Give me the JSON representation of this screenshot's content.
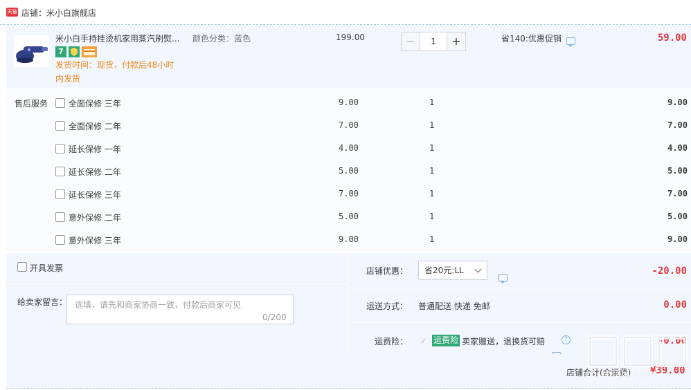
{
  "shop": {
    "logo_text": "天猫",
    "name_label": "店铺：米小白旗舰店"
  },
  "product": {
    "title": "米小白手持挂烫机家用蒸汽刷熨斗",
    "title_display": "米小白手持挂烫机家用蒸汽刷熨...",
    "spec": "颜色分类：蓝色",
    "badge_7": "7",
    "ship_time_line1": "发货时间：现货，付款后48小时",
    "ship_time_line2": "内发货",
    "unit_price": "199.00",
    "quantity": "1",
    "minus": "−",
    "plus": "+",
    "promo": "省140:优惠促销",
    "subtotal": "59.00"
  },
  "services": {
    "label": "售后服务",
    "items": [
      {
        "name": "全面保修 三年",
        "price": "9.00",
        "qty": "1",
        "subtotal": "9.00"
      },
      {
        "name": "全面保修 二年",
        "price": "7.00",
        "qty": "1",
        "subtotal": "7.00"
      },
      {
        "name": "延长保修 一年",
        "price": "4.00",
        "qty": "1",
        "subtotal": "4.00"
      },
      {
        "name": "延长保修 二年",
        "price": "5.00",
        "qty": "1",
        "subtotal": "5.00"
      },
      {
        "name": "延长保修 三年",
        "price": "7.00",
        "qty": "1",
        "subtotal": "7.00"
      },
      {
        "name": "意外保修 二年",
        "price": "5.00",
        "qty": "1",
        "subtotal": "5.00"
      },
      {
        "name": "意外保修 三年",
        "price": "9.00",
        "qty": "1",
        "subtotal": "9.00"
      }
    ]
  },
  "invoice": {
    "label": "开具发票"
  },
  "message": {
    "label": "给卖家留言：",
    "placeholder": "选填，请先和商家协商一致，付款后商家可见",
    "count": "0/200"
  },
  "discount": {
    "label": "店铺优惠：",
    "selected": "省20元:LL",
    "amount": "-20.00"
  },
  "shipping": {
    "label": "运送方式：",
    "value": "普通配送 快递 免邮",
    "amount": "0.00"
  },
  "insurance": {
    "label": "运费险：",
    "tag": "运费险",
    "desc": "卖家赠送，退换货可赔",
    "amount": "-0.00"
  },
  "total": {
    "label": "店铺合计(含运费)",
    "amount": "¥39.00"
  },
  "watermark": {
    "text": "zhizhizhi.com"
  },
  "colors": {
    "price_red": "#e4393c",
    "accent_green": "#2fa876",
    "ship_orange": "#ef8a1f",
    "panel_blue": "#f2f7ff"
  }
}
